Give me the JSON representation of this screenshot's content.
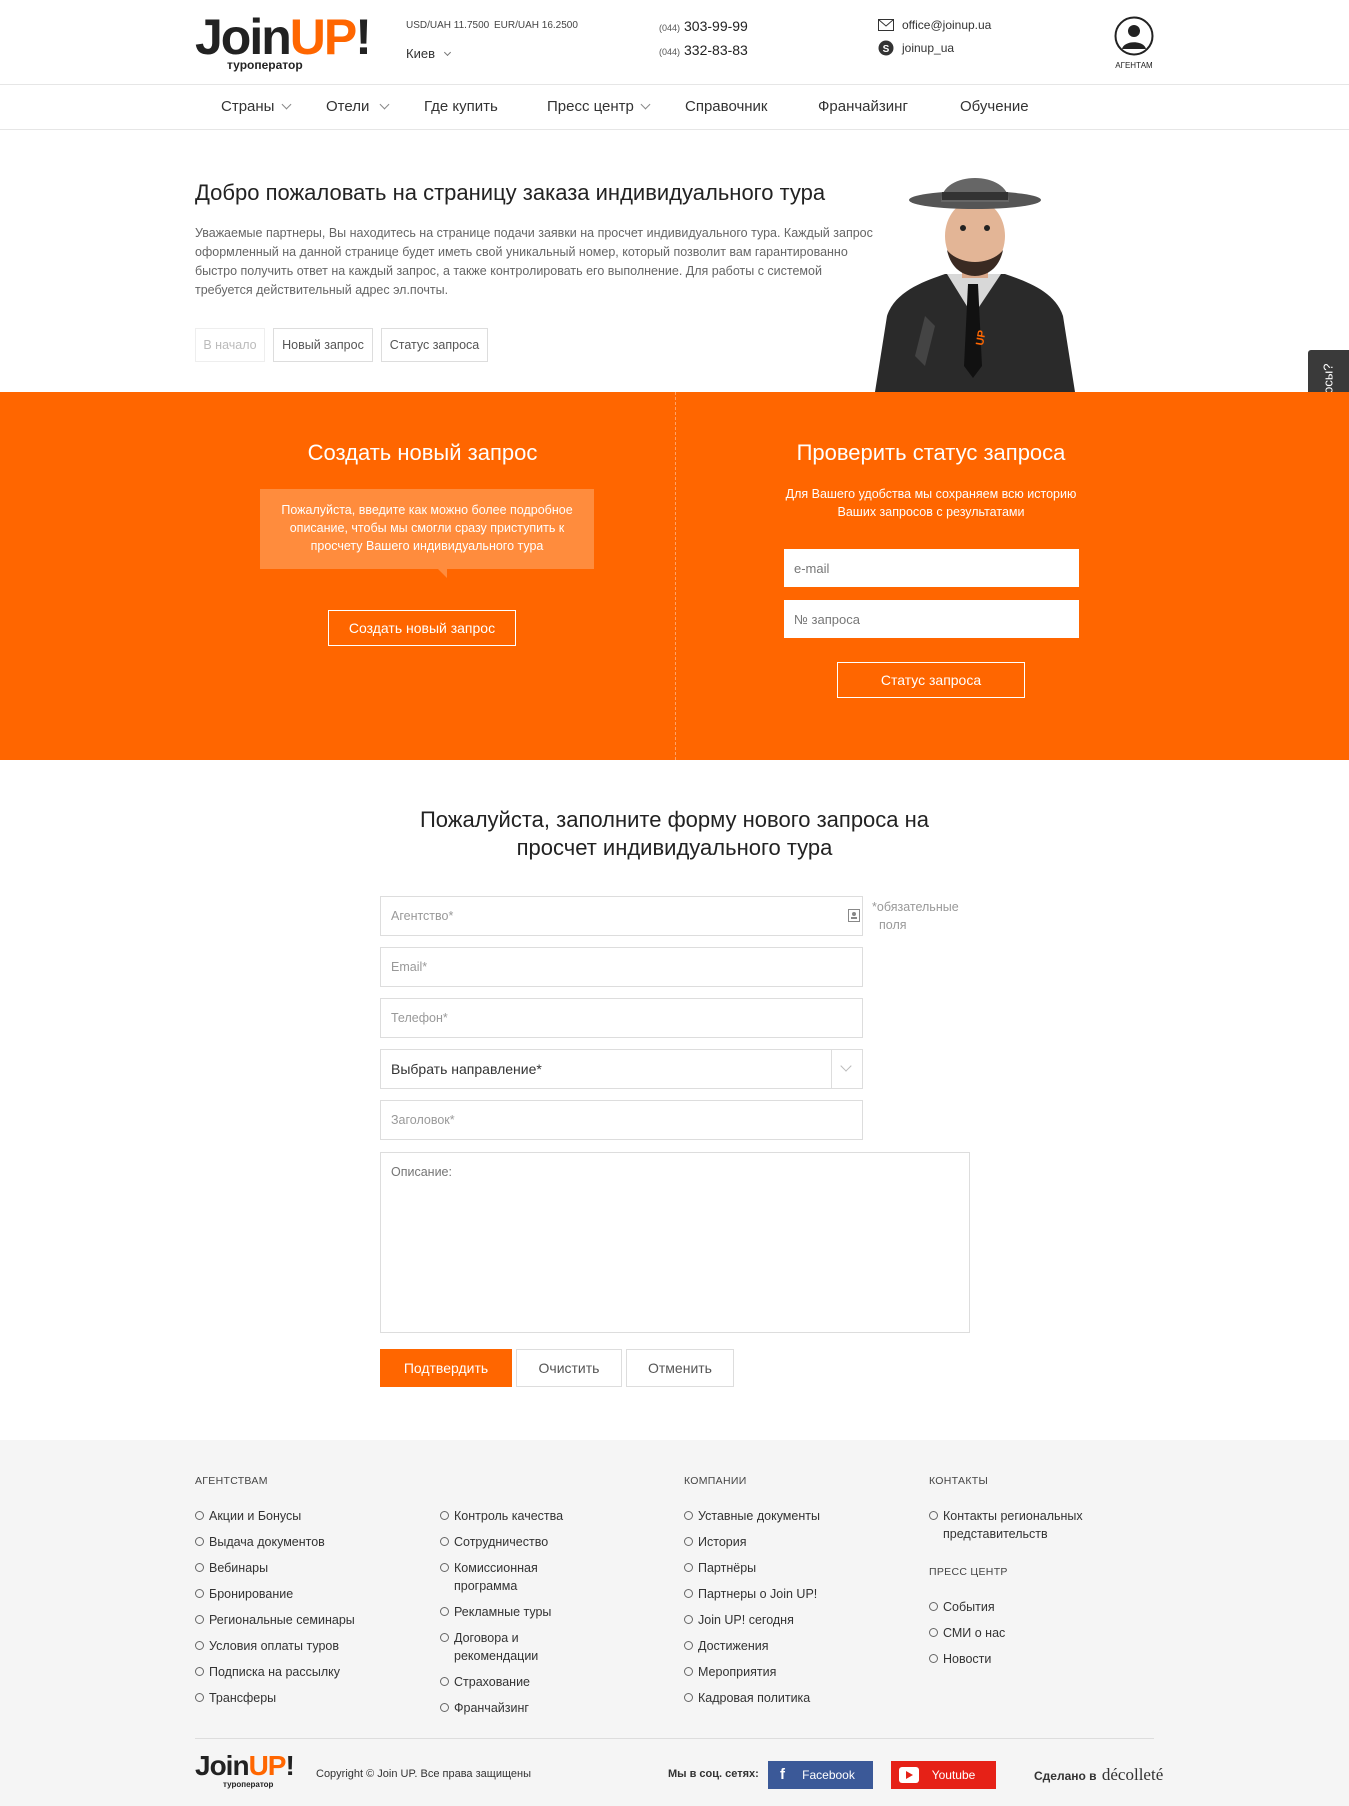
{
  "header": {
    "logo_join": "Join",
    "logo_up": "UP",
    "logo_bang": "!",
    "logo_sub": "туроператор",
    "rate_usd": "USD/UAH 11.7500",
    "rate_eur": "EUR/UAH 16.2500",
    "city": "Киев",
    "phones": [
      {
        "code": "(044)",
        "number": "303-99-99"
      },
      {
        "code": "(044)",
        "number": "332-83-83"
      }
    ],
    "email": "office@joinup.ua",
    "skype": "joinup_ua",
    "agents": "АГЕНТАМ"
  },
  "nav": {
    "items": [
      {
        "label": "Страны",
        "dropdown": true
      },
      {
        "label": "Отели",
        "dropdown": true
      },
      {
        "label": "Где купить",
        "dropdown": false
      },
      {
        "label": "Пресс центр",
        "dropdown": true
      },
      {
        "label": "Справочник",
        "dropdown": false
      },
      {
        "label": "Франчайзинг",
        "dropdown": false
      },
      {
        "label": "Обучение",
        "dropdown": false
      }
    ]
  },
  "hero": {
    "title": "Добро пожаловать на страницу заказа индивидуального тура",
    "lines": [
      "Уважаемые партнеры, Вы находитесь на странице подачи заявки на просчет индивидуального тура. Каждый запрос",
      "оформленный на данной странице будет иметь свой уникальный номер, который позволит вам гарантированно",
      "быстро получить ответ на каждый запрос, а также контролировать его выполнение. Для работы с системой",
      "требуется действительный адрес эл.почты."
    ],
    "buttons": [
      "В начало",
      "Новый запрос",
      "Статус запроса"
    ]
  },
  "side_tab": "Есть вопросы?",
  "orange": {
    "left_title": "Создать новый запрос",
    "bubble_lines": [
      "Пожалуйста, введите как можно более подробное",
      "описание, чтобы мы смогли сразу приступить к",
      "просчету Вашего индивидуального тура"
    ],
    "left_button": "Создать новый запрос",
    "right_title": "Проверить статус запроса",
    "right_lines": [
      "Для Вашего удобства мы сохраняем всю историю",
      "Ваших запросов с результатами"
    ],
    "email_placeholder": "e-mail",
    "number_placeholder": "№ запроса",
    "right_button": "Статус запроса"
  },
  "form": {
    "title_lines": [
      "Пожалуйста, заполните форму нового запроса на",
      "просчет индивидуального тура"
    ],
    "agency": "Агентство*",
    "email": "Email*",
    "phone": "Телефон*",
    "direction": "Выбрать направление*",
    "subject": "Заголовок*",
    "description": "Описание:",
    "required_note_lines": [
      "обязательные",
      "поля"
    ],
    "required_star": "*",
    "submit": "Подтвердить",
    "clear": "Очистить",
    "cancel": "Отменить"
  },
  "footer": {
    "col1_title": "АГЕНТСТВАМ",
    "col1": [
      "Акции и Бонусы",
      "Выдача документов",
      "Вебинары",
      "Бронирование",
      "Региональные семинары",
      "Условия оплаты туров",
      "Подписка на рассылку",
      "Трансферы"
    ],
    "col2": [
      [
        "Контроль качества"
      ],
      [
        "Сотрудничество"
      ],
      [
        "Комиссионная",
        "программа"
      ],
      [
        "Рекламные туры"
      ],
      [
        "Договора и",
        "рекомендации"
      ],
      [
        "Страхование"
      ],
      [
        "Франчайзинг"
      ]
    ],
    "col3_title": "КОМПАНИИ",
    "col3": [
      "Уставные документы",
      "История",
      "Партнёры",
      "Партнеры о Join UP!",
      "Join UP! сегодня",
      "Достижения",
      "Мероприятия",
      "Кадровая политика"
    ],
    "col4_title": "КОНТАКТЫ",
    "col4": [
      [
        "Контакты региональных",
        "представительств"
      ]
    ],
    "col5_title": "ПРЕСС ЦЕНТР",
    "col5": [
      "События",
      "СМИ о нас",
      "Новости"
    ],
    "copyright": "Copyright © Join UP. Все права защищены",
    "social_label": "Мы в соц. сетях:",
    "facebook": "Facebook",
    "youtube": "Youtube",
    "made_by": "Сделано в",
    "studio": "décolleté"
  },
  "colors": {
    "accent": "#ff6600",
    "bubble": "#ff8c3d",
    "facebook": "#3b5998",
    "youtube": "#e62117",
    "side_tab": "#3a3a3a"
  }
}
